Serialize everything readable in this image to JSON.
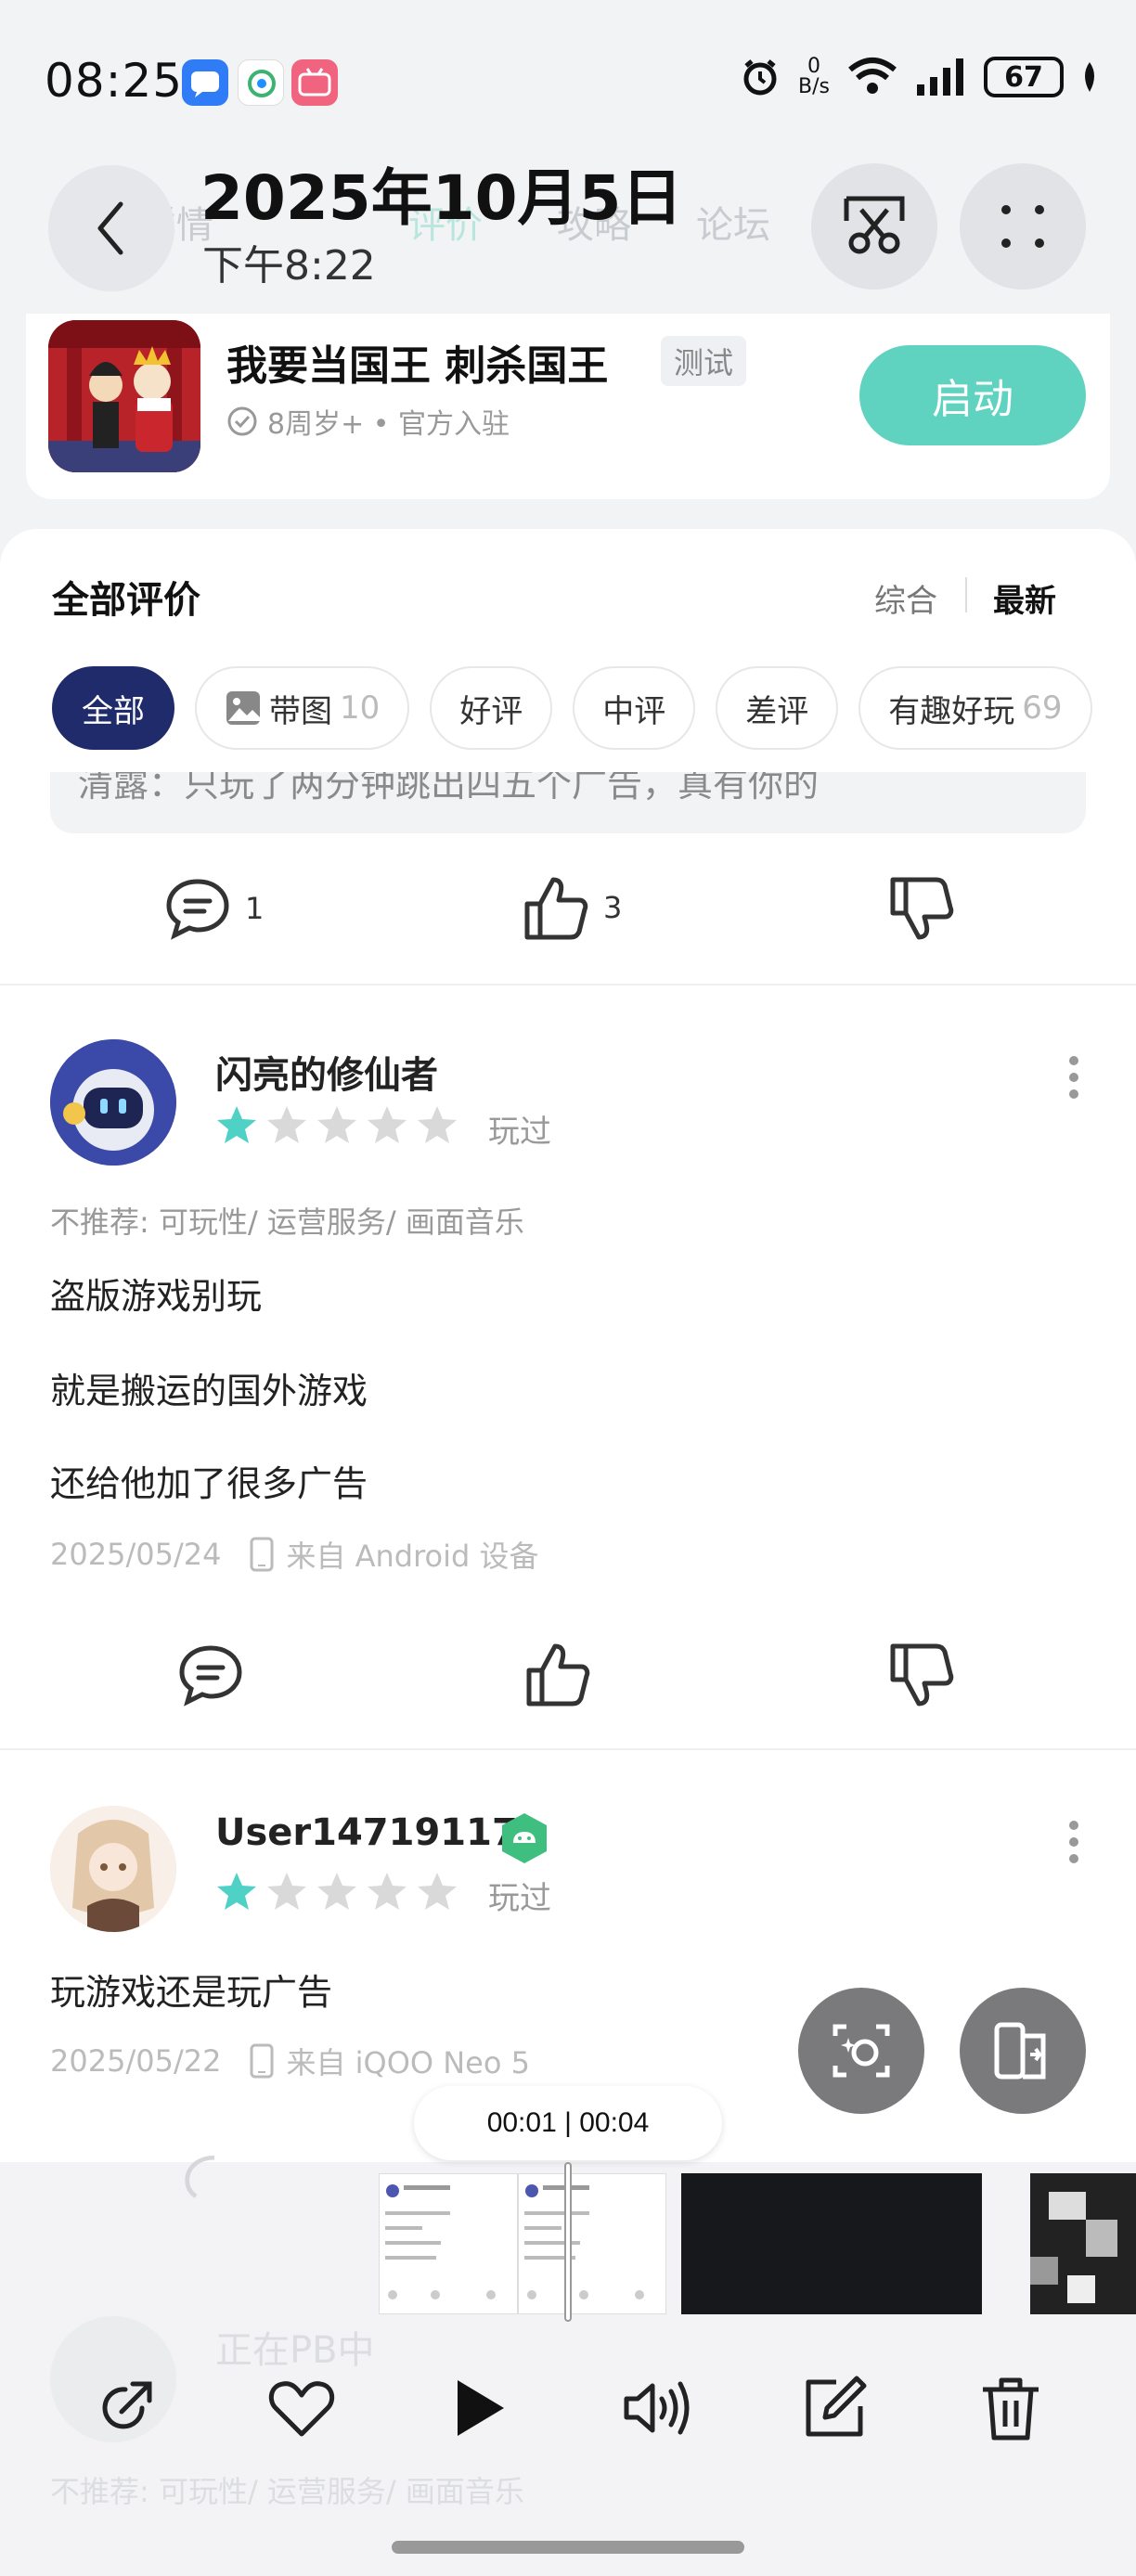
{
  "status_bar": {
    "time": "08:25",
    "net_speed_value": "0",
    "net_speed_unit": "B/s",
    "battery": "67"
  },
  "header": {
    "date": "2025年10月5日",
    "time": "下午8:22",
    "ghost_tabs": [
      "详情",
      "评价",
      "攻略",
      "论坛"
    ]
  },
  "game": {
    "title": "我要当国王 刺杀国王",
    "tag": "测试",
    "meta": "8周岁+ • 官方入驻",
    "launch_label": "启动"
  },
  "reviews_section": {
    "title": "全部评价",
    "sort_options": [
      "综合",
      "最新"
    ],
    "sort_active": "最新"
  },
  "filter_chips": [
    {
      "label": "全部",
      "count": "",
      "active": true
    },
    {
      "label": "带图",
      "count": "10",
      "active": false
    },
    {
      "label": "好评",
      "count": "",
      "active": false
    },
    {
      "label": "中评",
      "count": "",
      "active": false
    },
    {
      "label": "差评",
      "count": "",
      "active": false
    },
    {
      "label": "有趣好玩",
      "count": "69",
      "active": false
    }
  ],
  "prev_review": {
    "quote_fragment": "清露：只玩了两分钟跳出四五个广告，真有你的",
    "comments": "1",
    "likes": "3"
  },
  "reviews": [
    {
      "username": "闪亮的修仙者",
      "rating": 1,
      "max_rating": 5,
      "status": "玩过",
      "recommend": "不推荐: 可玩性/ 运营服务/ 画面音乐",
      "lines": [
        "盗版游戏别玩",
        "就是搬运的国外游戏",
        "还给他加了很多广告"
      ],
      "date": "2025/05/24",
      "device": "来自 Android 设备"
    },
    {
      "username": "User14719117",
      "rating": 1,
      "max_rating": 5,
      "status": "玩过",
      "lines": [
        "玩游戏还是玩广告"
      ],
      "date": "2025/05/22",
      "device": "来自 iQOO Neo 5"
    },
    {
      "username": "正在PB中",
      "recommend": "不推荐: 可玩性/ 运营服务/ 画面音乐"
    }
  ],
  "video_editor": {
    "timestamp": "00:01 | 00:04"
  },
  "colors": {
    "accent_teal": "#5fd3c0",
    "chip_active": "#1f2b6b",
    "star_filled": "#4fd1c5",
    "star_empty": "#d9d9d9"
  }
}
